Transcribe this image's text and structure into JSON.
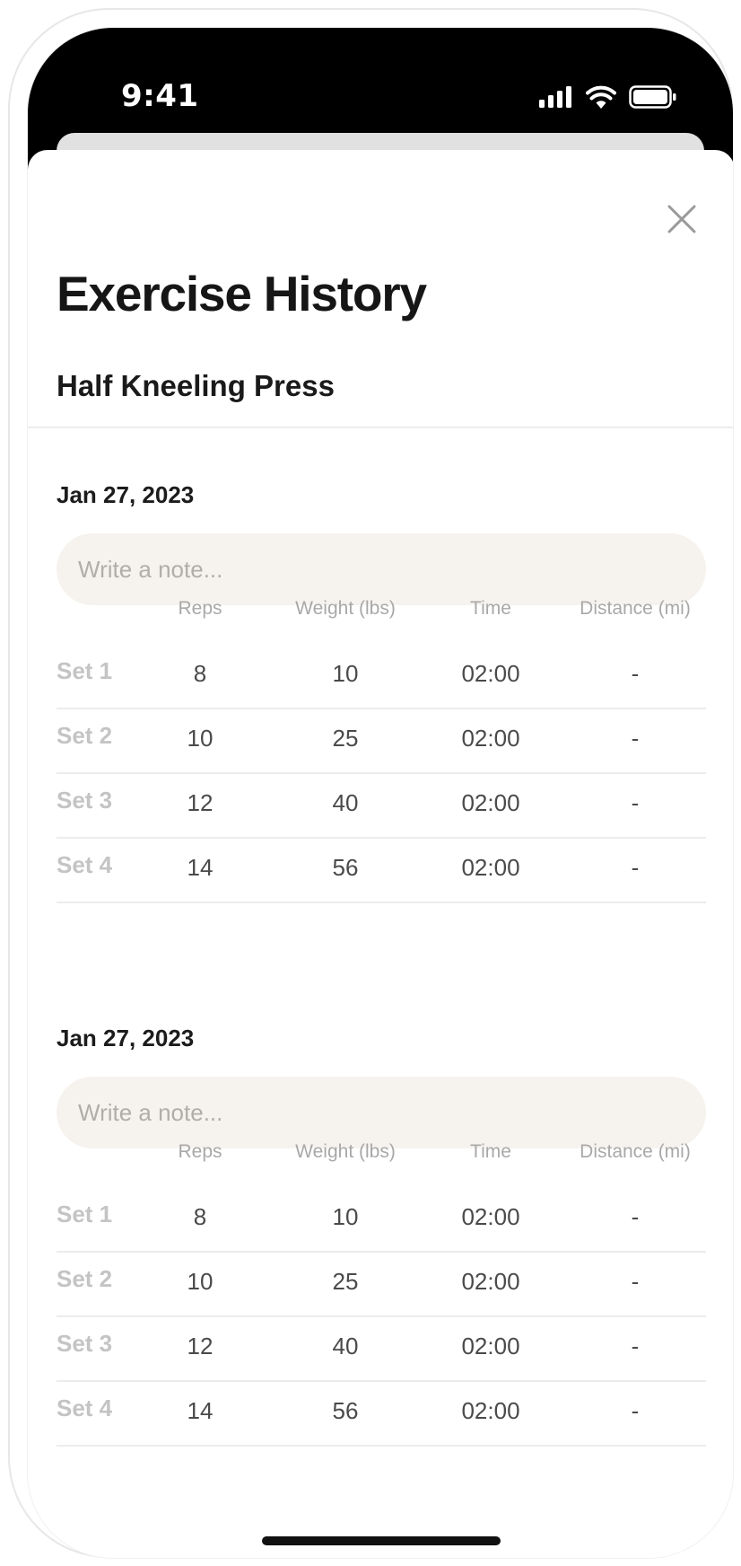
{
  "status_bar": {
    "time": "9:41",
    "icons": [
      "signal-bars-icon",
      "wifi-icon",
      "battery-icon"
    ]
  },
  "modal": {
    "close_icon": "close-icon",
    "title": "Exercise History",
    "exercise_name": "Half Kneeling Press"
  },
  "table_columns": {
    "reps": "Reps",
    "weight": "Weight (lbs)",
    "time": "Time",
    "distance": "Distance (mi)"
  },
  "sessions": [
    {
      "date": "Jan 27, 2023",
      "note_placeholder": "Write a note...",
      "note_value": "",
      "sets": [
        {
          "label": "Set 1",
          "reps": "8",
          "weight": "10",
          "time": "02:00",
          "distance": "-"
        },
        {
          "label": "Set 2",
          "reps": "10",
          "weight": "25",
          "time": "02:00",
          "distance": "-"
        },
        {
          "label": "Set 3",
          "reps": "12",
          "weight": "40",
          "time": "02:00",
          "distance": "-"
        },
        {
          "label": "Set 4",
          "reps": "14",
          "weight": "56",
          "time": "02:00",
          "distance": "-"
        }
      ]
    },
    {
      "date": "Jan 27, 2023",
      "note_placeholder": "Write a note...",
      "note_value": "",
      "sets": [
        {
          "label": "Set 1",
          "reps": "8",
          "weight": "10",
          "time": "02:00",
          "distance": "-"
        },
        {
          "label": "Set 2",
          "reps": "10",
          "weight": "25",
          "time": "02:00",
          "distance": "-"
        },
        {
          "label": "Set 3",
          "reps": "12",
          "weight": "40",
          "time": "02:00",
          "distance": "-"
        },
        {
          "label": "Set 4",
          "reps": "14",
          "weight": "56",
          "time": "02:00",
          "distance": "-"
        }
      ]
    }
  ],
  "colors": {
    "accent_text": "#161616",
    "note_background": "#f6f3ef",
    "muted_text": "#a8a8a8",
    "set_label": "#c4c4c4",
    "divider": "#ececec"
  }
}
